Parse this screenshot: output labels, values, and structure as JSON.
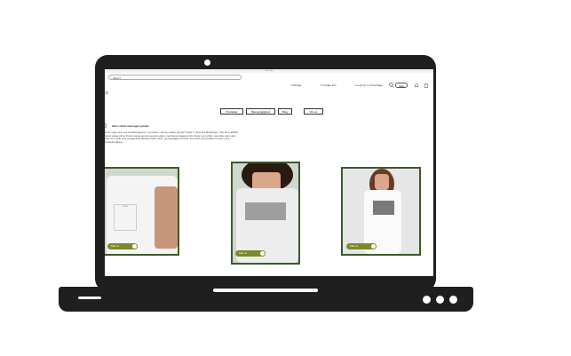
{
  "browser": {
    "window_title": "Web Page",
    "url": "https://"
  },
  "header": {
    "nav": [
      "Forfrage",
      "Fri fragte info",
      "Levering: 1-3 hverdage"
    ],
    "search_label": "Søg"
  },
  "tabs": [
    "Produkter",
    "Bæredygtighed",
    "Blog",
    "Om os"
  ],
  "content": {
    "heading": "Alle t-shirts med egen printer",
    "paragraph": "Er du ogsa ved med mediedesignsom, og ønsker i denne vedste og kort? Dette T-shirts Fra Mediestyle. Vær din butiksfrit hel at vælge printe fra de mange gonner gennem dette, med deres slogans print, bluser og t-shirts, med eller uden dem selv. Vi er stolt med medieprinter tilpasse fuldt, t-shirt, grundvæggen til hvide. En t-shirt med profiler til vores. Læs i herstede tilgang."
  },
  "products": [
    {
      "button_label": "Køb nu",
      "print_text": "Share"
    },
    {
      "button_label": "Køb nu",
      "print_text": ""
    },
    {
      "button_label": "Køb nu",
      "print_text": ""
    }
  ],
  "colors": {
    "card_border": "#3c5a2a",
    "button": "#7a8b2a",
    "laptop": "#1f1f1f"
  }
}
